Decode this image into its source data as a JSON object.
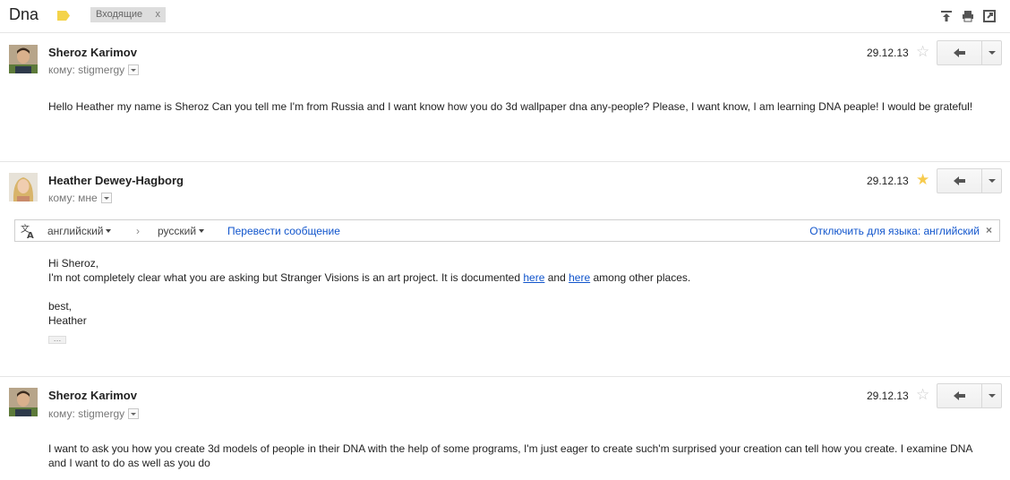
{
  "thread": {
    "subject": "Dna",
    "label": "Входящие",
    "label_close": "x"
  },
  "translate_bar": {
    "source_language": "английский",
    "target_language": "русский",
    "translate_link": "Перевести сообщение",
    "disable_link": "Отключить для языка: английский"
  },
  "messages": [
    {
      "sender": "Sheroz Karimov",
      "to_line": "кому: stigmergy",
      "date": "29.12.13",
      "starred": false,
      "body": [
        "Hello Heather my name is Sheroz Can you tell me I'm from Russia and I want know how you do 3d wallpaper dna any-people? Please, I want know, I am learning DNA peaple! I would be grateful!"
      ]
    },
    {
      "sender": "Heather Dewey-Hagborg",
      "to_line": "кому: мне",
      "date": "29.12.13",
      "starred": true,
      "body": {
        "greeting": "Hi Sheroz,",
        "line_before": "I'm not completely clear what you are asking but Stranger Visions is an art project. It is documented",
        "link1": "here",
        "between": "and",
        "link2": "here",
        "line_after": "among other places.",
        "signoff": "best,",
        "name": "Heather"
      },
      "quoted_toggle": "…"
    },
    {
      "sender": "Sheroz Karimov",
      "to_line": "кому: stigmergy",
      "date": "29.12.13",
      "starred": false,
      "body": [
        "I want to ask you how you create 3d models of people in their DNA with the help of some programs, I'm just eager to create such'm surprised your creation can tell how you create. I examine DNA and I want to do as well as you do"
      ]
    }
  ],
  "colors": {
    "link": "#1155cc",
    "star_on": "#f7cb4d",
    "star_off": "#c9c9c9",
    "label_tag": "#f4d34a"
  }
}
